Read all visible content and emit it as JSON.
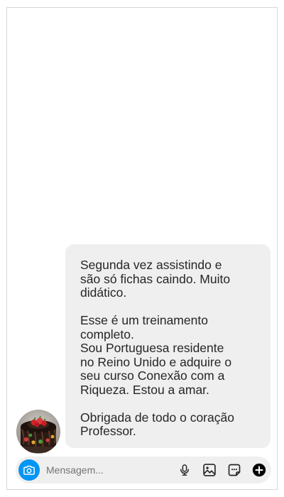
{
  "thread": {
    "message": {
      "paragraphs": [
        "Segunda vez assistindo e\nsão só fichas caindo. Muito\ndidático.",
        "Esse é um treinamento\ncompleto.\nSou Portuguesa residente\nno Reino Unido e adquire o\nseu curso Conexão com a\nRiqueza. Estou a amar.",
        "Obrigada de todo o coração\nProfessor."
      ]
    },
    "sender_avatar_icon": "cake-avatar"
  },
  "composer": {
    "placeholder": "Mensagem...",
    "icons": [
      "camera-icon",
      "microphone-icon",
      "gallery-icon",
      "sticker-icon",
      "add-icon"
    ]
  },
  "colors": {
    "accent": "#0095f6",
    "bubble": "#efefef",
    "text": "#262626",
    "placeholder": "#737373"
  }
}
